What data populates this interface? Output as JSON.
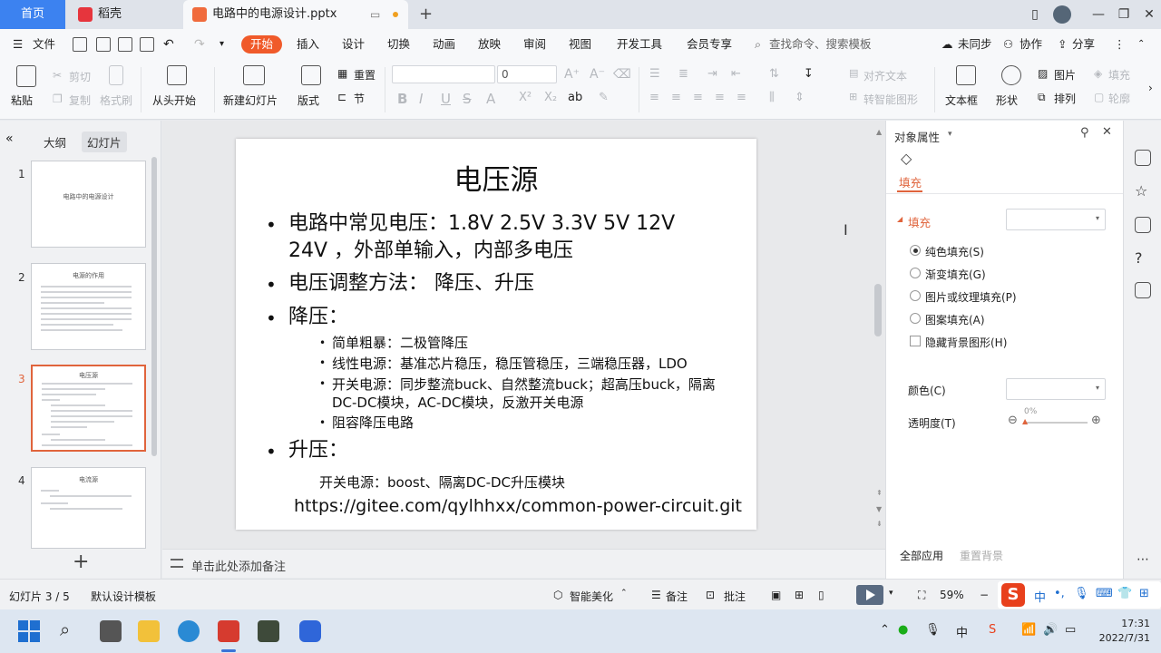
{
  "tabs": {
    "home": "首页",
    "daoke": "稻壳",
    "document": "电路中的电源设计.pptx"
  },
  "menu": {
    "file": "文件",
    "items": [
      "开始",
      "插入",
      "设计",
      "切换",
      "动画",
      "放映",
      "审阅",
      "视图",
      "开发工具",
      "会员专享"
    ],
    "search_placeholder": "查找命令、搜索模板",
    "unsynced": "未同步",
    "collab": "协作",
    "share": "分享"
  },
  "ribbon": {
    "paste": "粘贴",
    "cut": "剪切",
    "copy": "复制",
    "format_painter": "格式刷",
    "from_start": "从头开始",
    "new_slide": "新建幻灯片",
    "layout": "版式",
    "reset": "重置",
    "section": "节",
    "font_size": "0",
    "align_text": "对齐文本",
    "to_smartart": "转智能图形",
    "textbox": "文本框",
    "shape": "形状",
    "picture": "图片",
    "arrange": "排列",
    "fill": "填充",
    "outline": "轮廓"
  },
  "left_panel": {
    "outline_tab": "大纲",
    "slides_tab": "幻灯片",
    "thumbs": [
      {
        "num": "1",
        "title": "电路中的电源设计"
      },
      {
        "num": "2",
        "title": "电源的作用"
      },
      {
        "num": "3",
        "title": "电压源"
      },
      {
        "num": "4",
        "title": "电流源"
      }
    ]
  },
  "slide": {
    "title": "电压源",
    "b1_line1": "电路中常见电压：1.8V 2.5V 3.3V 5V 12V",
    "b1_line2": "24V ，外部单输入，内部多电压",
    "b2": "电压调整方法： 降压、升压",
    "b3": "降压：",
    "sub1": "简单粗暴：二极管降压",
    "sub2": "线性电源：基准芯片稳压，稳压管稳压，三端稳压器，LDO",
    "sub3_line1": "开关电源：同步整流buck、自然整流buck；超高压buck，隔离",
    "sub3_line2": "DC-DC模块，AC-DC模块，反激开关电源",
    "sub4": "阻容降压电路",
    "b4": "升压：",
    "boost": "开关电源：boost、隔离DC-DC升压模块",
    "url": "https://gitee.com/qylhhxx/common-power-circuit.git"
  },
  "notes_placeholder": "单击此处添加备注",
  "right_panel": {
    "title": "对象属性",
    "fill_tab": "填充",
    "fill_section": "填充",
    "options": [
      "纯色填充(S)",
      "渐变填充(G)",
      "图片或纹理填充(P)",
      "图案填充(A)"
    ],
    "selected_option": 0,
    "hide_bg": "隐藏背景图形(H)",
    "color": "颜色(C)",
    "transparency": "透明度(T)",
    "transparency_value": "0%",
    "apply_all": "全部应用",
    "reset_bg": "重置背景"
  },
  "status": {
    "slide_count": "幻灯片 3 / 5",
    "template": "默认设计模板",
    "beautify": "智能美化",
    "notes": "备注",
    "comments": "批注",
    "zoom": "59%"
  },
  "taskbar": {
    "lang": "中",
    "ime_lang": "中",
    "time": "17:31",
    "date": "2022/7/31"
  },
  "colors": {
    "accent": "#e0643c",
    "home_tab": "#3c82f0"
  }
}
